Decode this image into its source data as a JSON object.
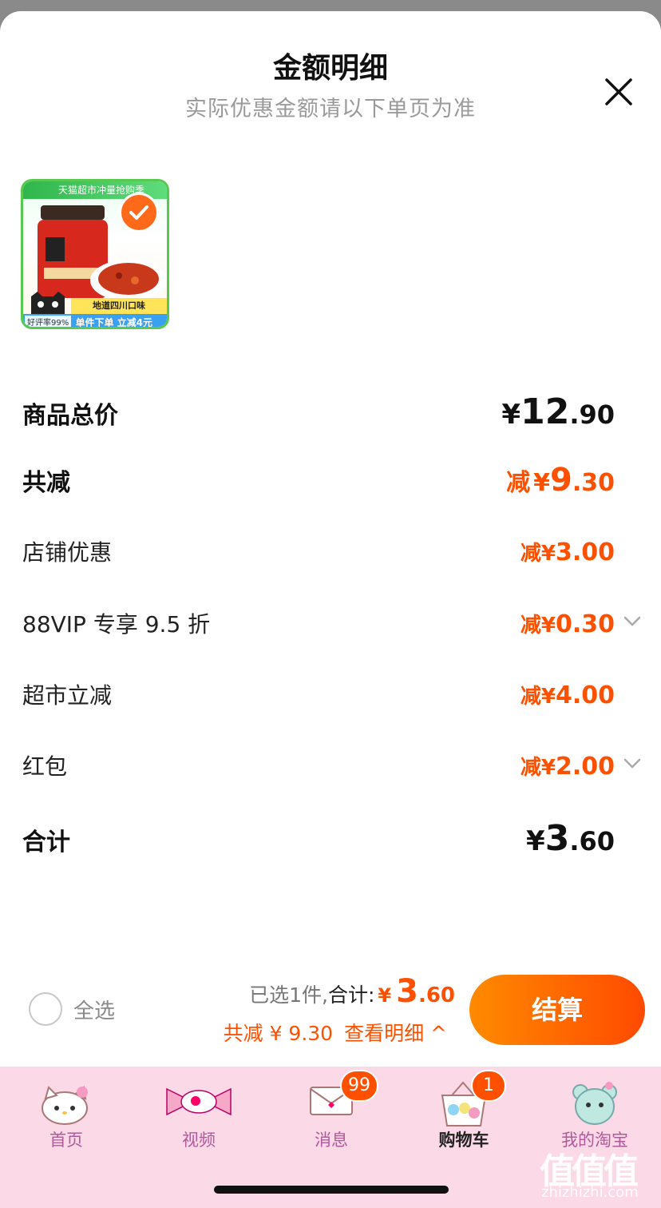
{
  "header": {
    "title": "金额明细",
    "subtitle": "实际优惠金额请以下单页为准"
  },
  "product": {
    "banner_text": "天猫超市冲量抢购季",
    "strip_text": "地道四川口味",
    "promo_text": "单件下单 立减4元",
    "rating_text": "好评率99%"
  },
  "rows": {
    "total_price": {
      "label": "商品总价",
      "currency": "¥",
      "int": "12",
      "dec": ".90"
    },
    "total_discount": {
      "label": "共减",
      "prefix": "减",
      "currency": "¥",
      "int": "9",
      "dec": ".30"
    },
    "shop_discount": {
      "label": "店铺优惠",
      "value": "减¥",
      "int": "3",
      "dec": ".00"
    },
    "vip_discount": {
      "label": "88VIP 专享 9.5 折",
      "value": "减¥",
      "int": "0",
      "dec": ".30"
    },
    "market_discount": {
      "label": "超市立减",
      "value": "减¥",
      "int": "4",
      "dec": ".00"
    },
    "red_packet": {
      "label": "红包",
      "value": "减¥",
      "int": "2",
      "dec": ".00"
    },
    "sum": {
      "label": "合计",
      "currency": "¥",
      "int": "3",
      "dec": ".60"
    }
  },
  "footer": {
    "select_all": "全选",
    "selected_text": "已选1件,",
    "total_label": "合计:",
    "currency": "¥",
    "total_int": "3",
    "total_dec": ".60",
    "saved_text": "共减 ¥ 9.30",
    "detail_text": "查看明细 ^",
    "checkout": "结算"
  },
  "tabbar": {
    "tabs": [
      {
        "label": "首页",
        "icon": "hello-kitty-icon"
      },
      {
        "label": "视频",
        "icon": "candy-icon"
      },
      {
        "label": "消息",
        "icon": "envelope-icon",
        "badge": "99"
      },
      {
        "label": "购物车",
        "icon": "cart-basket-icon",
        "badge": "1"
      },
      {
        "label": "我的淘宝",
        "icon": "bear-icon"
      }
    ]
  },
  "watermark": {
    "text": "值值值",
    "url": "zhizhizhi.com"
  },
  "colors": {
    "accent": "#ff5000",
    "tabbar_bg": "#fbd9e6"
  }
}
